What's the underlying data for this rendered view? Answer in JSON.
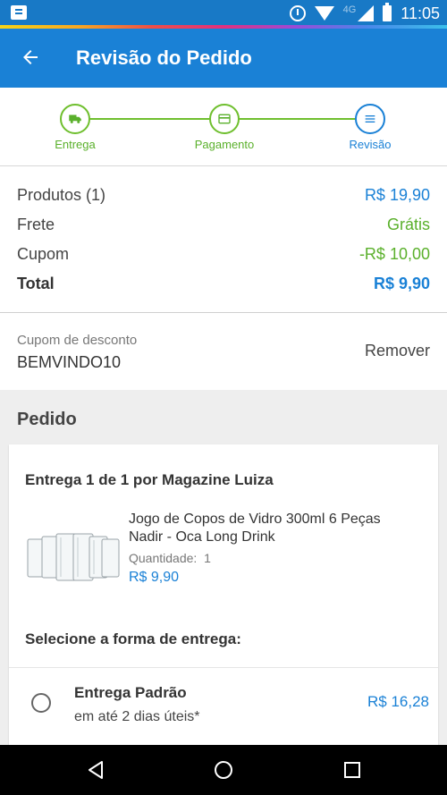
{
  "status_bar": {
    "time": "11:05",
    "network": "4G"
  },
  "app_bar": {
    "title": "Revisão do Pedido"
  },
  "stepper": {
    "steps": [
      {
        "label": "Entrega"
      },
      {
        "label": "Pagamento"
      },
      {
        "label": "Revisão"
      }
    ]
  },
  "summary": {
    "produtos_label": "Produtos (1)",
    "produtos_value": "R$ 19,90",
    "frete_label": "Frete",
    "frete_value": "Grátis",
    "cupom_label": "Cupom",
    "cupom_value": "-R$ 10,00",
    "total_label": "Total",
    "total_value": "R$ 9,90"
  },
  "coupon": {
    "label": "Cupom de desconto",
    "code": "BEMVINDO10",
    "remove_label": "Remover"
  },
  "pedido": {
    "heading": "Pedido",
    "delivery_heading": "Entrega 1 de 1 por Magazine Luiza",
    "product": {
      "name": "Jogo de Copos de Vidro 300ml 6 Peças Nadir - Oca Long Drink",
      "quantity_label": "Quantidade:",
      "quantity_value": "1",
      "price": "R$ 9,90"
    },
    "shipping_heading": "Selecione a forma de entrega:",
    "shipping_option": {
      "name": "Entrega Padrão",
      "description": "em até 2 dias úteis*",
      "price": "R$ 16,28"
    }
  },
  "colors": {
    "primary": "#1a81d6",
    "success": "#5ab02b"
  }
}
